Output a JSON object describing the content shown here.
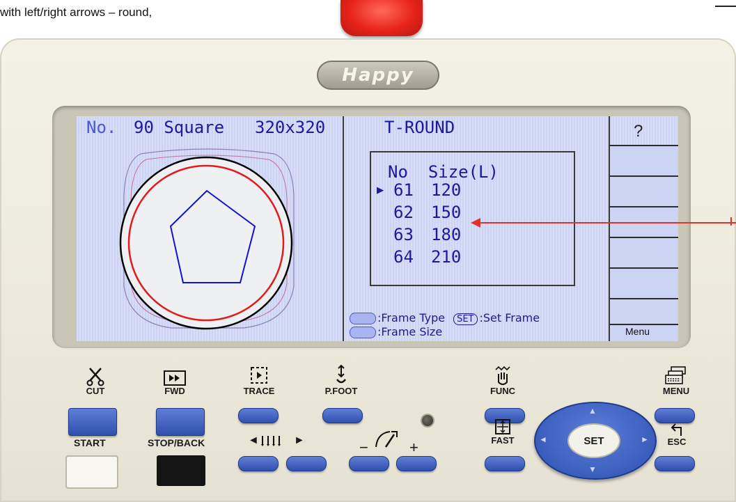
{
  "caption": "with left/right arrows – round,",
  "logo": "Happy",
  "screen": {
    "no_label": "No.",
    "design_name": "90 Square",
    "design_size": "320x320",
    "frame_family": "T-ROUND",
    "help_symbol": "?",
    "size_table": {
      "header_no": "No",
      "header_size": "Size(L)",
      "rows": [
        {
          "no": "61",
          "size": "120",
          "selected": true
        },
        {
          "no": "62",
          "size": "150",
          "selected": false
        },
        {
          "no": "63",
          "size": "180",
          "selected": false
        },
        {
          "no": "64",
          "size": "210",
          "selected": false
        }
      ],
      "selection_marker": "▶"
    },
    "hint_frame_type": ":Frame Type",
    "hint_set_chip": "SET",
    "hint_set_frame": ":Set Frame",
    "hint_frame_size": ":Frame Size",
    "menu_label": "Menu"
  },
  "keys": {
    "cut": "CUT",
    "fwd": "FWD",
    "trace": "TRACE",
    "pfoot": "P.FOOT",
    "func": "FUNC",
    "menu": "MENU",
    "start": "START",
    "stop_back": "STOP/BACK",
    "fast": "FAST",
    "esc": "ESC",
    "set": "SET",
    "minus": "−",
    "plus": "+"
  },
  "icons": {
    "cut": "scissors-icon",
    "fwd": "fast-forward-icon",
    "trace": "trace-frame-icon",
    "pfoot": "presser-foot-icon",
    "func": "hand-function-icon",
    "menu": "keyboard-menu-icon",
    "fast": "fast-icon",
    "esc": "return-arrow-icon",
    "needle_select": "needle-bar-icon",
    "speed": "speedometer-icon",
    "help": "question-icon"
  },
  "colors": {
    "screen_bg": "#d7dcf7",
    "screen_text": "#1a1a9a",
    "button_blue": "#3b5cc0",
    "stop_red": "#e8231a",
    "pointer_red": "#e53228",
    "panel_cream": "#efece0"
  }
}
